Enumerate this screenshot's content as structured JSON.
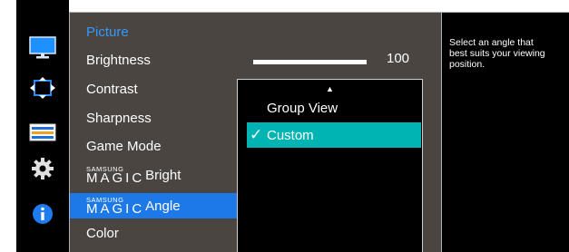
{
  "sidebar": {
    "icons": [
      {
        "name": "picture-icon"
      },
      {
        "name": "onscreen-display-icon"
      },
      {
        "name": "system-icon"
      },
      {
        "name": "settings-gear-icon"
      },
      {
        "name": "information-icon"
      }
    ]
  },
  "menu": {
    "category": "Picture",
    "items": [
      {
        "label": "Brightness"
      },
      {
        "label": "Contrast"
      },
      {
        "label": "Sharpness"
      },
      {
        "label": "Game Mode"
      },
      {
        "prefix_small": "SAMSUNG",
        "prefix_large": "MAGIC",
        "label": "Bright"
      },
      {
        "prefix_small": "SAMSUNG",
        "prefix_large": "MAGIC",
        "label": "Angle",
        "selected": true
      },
      {
        "label": "Color"
      }
    ]
  },
  "brightness": {
    "value": "100",
    "level": 1.0
  },
  "dropdown": {
    "options": [
      {
        "label": "Group View"
      },
      {
        "label": "Custom",
        "selected": true
      }
    ]
  },
  "description": "Select an angle that\nbest suits your viewing\nposition.",
  "colors": {
    "panel": "#4a4541",
    "category": "#3399ff",
    "selected_item": "#1d78e8",
    "selected_option": "#00b4b4"
  }
}
